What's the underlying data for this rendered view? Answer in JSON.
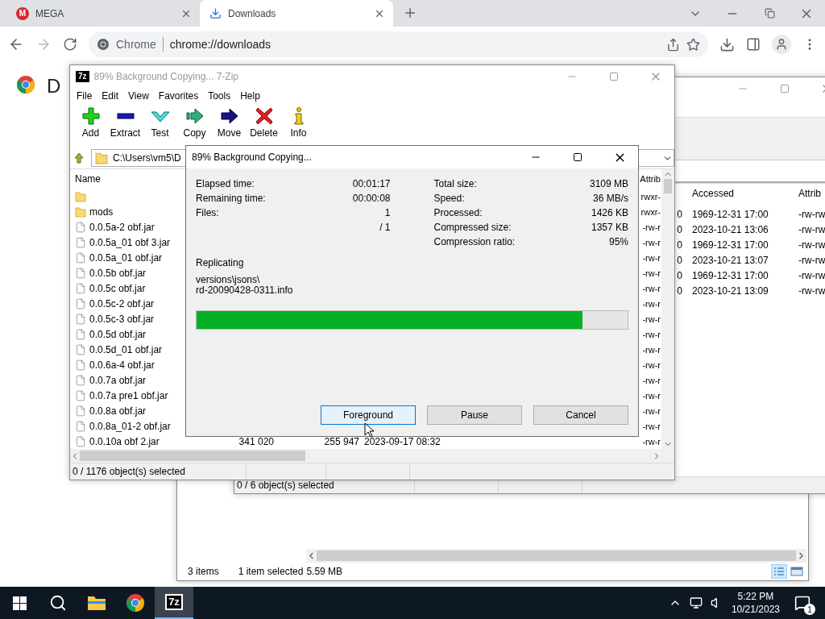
{
  "browser": {
    "tabs": [
      {
        "title": "MEGA",
        "kind": "mega",
        "icon_text": "M",
        "selected": false
      },
      {
        "title": "Downloads",
        "kind": "downloads",
        "selected": true
      }
    ],
    "omnibox": {
      "site_label": "Chrome",
      "url": "chrome://downloads"
    },
    "page": {
      "heading": "D"
    }
  },
  "explorer_window": {
    "status": {
      "items": "3 items",
      "selection": "1 item selected",
      "size": "5.59 MB"
    }
  },
  "archive_window_back": {
    "columns": [
      "Accessed",
      "Attrib"
    ],
    "rows": [
      {
        "column_tail": "0",
        "accessed": "1969-12-31 17:00",
        "attrib": "-rw-rw"
      },
      {
        "column_tail": "0",
        "accessed": "2023-10-21 13:06",
        "attrib": "-rw-rw"
      },
      {
        "column_tail": "0",
        "accessed": "1969-12-31 17:00",
        "attrib": "-rw-rw"
      },
      {
        "column_tail": "0",
        "accessed": "2023-10-21 13:07",
        "attrib": "-rw-rw"
      },
      {
        "column_tail": "0",
        "accessed": "1969-12-31 17:00",
        "attrib": "-rw-rw"
      },
      {
        "column_tail": "0",
        "accessed": "2023-10-21 13:09",
        "attrib": "-rw-rw"
      }
    ],
    "status": "0 / 6 object(s) selected"
  },
  "archive_window": {
    "icon_text": "7z",
    "title": "89% Background Copying... 7-Zip",
    "menu": [
      "File",
      "Edit",
      "View",
      "Favorites",
      "Tools",
      "Help"
    ],
    "toolbar": [
      {
        "label": "Add",
        "kind": "add"
      },
      {
        "label": "Extract",
        "kind": "extract"
      },
      {
        "label": "Test",
        "kind": "test"
      },
      {
        "label": "Copy",
        "kind": "copy"
      },
      {
        "label": "Move",
        "kind": "move"
      },
      {
        "label": "Delete",
        "kind": "delete"
      },
      {
        "label": "Info",
        "kind": "info"
      }
    ],
    "path": "C:\\Users\\vm5\\D",
    "columns": {
      "name": "Name",
      "attrib": "Attrib"
    },
    "rows": [
      {
        "kind": "folder",
        "attrib": "rwxr-"
      },
      {
        "name": "mods",
        "kind": "folder",
        "attrib": "rwxr-"
      },
      {
        "name": "0.0.5a-2 obf.jar",
        "kind": "file",
        "attrib": "-rw-r"
      },
      {
        "name": "0.0.5a_01 obf 3.jar",
        "kind": "file",
        "attrib": "-rw-r"
      },
      {
        "name": "0.0.5a_01 obf.jar",
        "kind": "file",
        "attrib": "-rw-r"
      },
      {
        "name": "0.0.5b obf.jar",
        "kind": "file",
        "attrib": "-rw-r"
      },
      {
        "name": "0.0.5c obf.jar",
        "kind": "file",
        "attrib": "-rw-r"
      },
      {
        "name": "0.0.5c-2 obf.jar",
        "kind": "file",
        "attrib": "-rw-r"
      },
      {
        "name": "0.0.5c-3 obf.jar",
        "kind": "file",
        "attrib": "-rw-r"
      },
      {
        "name": "0.0.5d obf.jar",
        "kind": "file",
        "attrib": "-rw-r"
      },
      {
        "name": "0.0.5d_01 obf.jar",
        "kind": "file",
        "attrib": "-rw-r"
      },
      {
        "name": "0.0.6a-4 obf.jar",
        "kind": "file",
        "attrib": "-rw-r"
      },
      {
        "name": "0.0.7a obf.jar",
        "kind": "file",
        "attrib": "-rw-r"
      },
      {
        "name": "0.0.7a pre1 obf.jar",
        "kind": "file",
        "attrib": "-rw-r"
      },
      {
        "name": "0.0.8a obf.jar",
        "kind": "file",
        "attrib": "-rw-r"
      },
      {
        "name": "0.0.8a_01-2 obf.jar",
        "kind": "file",
        "attrib": "-rw-r"
      },
      {
        "name": "0.0.10a obf 2.jar",
        "kind": "file",
        "size": "341 020",
        "packed": "255 947",
        "modified": "2023-09-17 08:32",
        "attrib": "-rw-r"
      }
    ],
    "status": "0 / 1176 object(s) selected"
  },
  "progress_dialog": {
    "title": "89% Background Copying...",
    "stats_left": [
      {
        "label": "Elapsed time:",
        "value": "00:01:17"
      },
      {
        "label": "Remaining time:",
        "value": "00:00:08"
      },
      {
        "label": "Files:",
        "value": "1"
      },
      {
        "value": "/ 1"
      }
    ],
    "stats_right": [
      {
        "label": "Total size:",
        "value": "3109 MB"
      },
      {
        "label": "Speed:",
        "value": "36 MB/s"
      },
      {
        "label": "Processed:",
        "value": "1426 KB"
      },
      {
        "label": "Compressed size:",
        "value": "1357 KB"
      },
      {
        "label": "Compression ratio:",
        "value": "95%"
      }
    ],
    "operation": "Replicating",
    "file_lines": [
      "versions\\jsons\\",
      "rd-20090428-0311.info"
    ],
    "progress": {
      "level": 0.895
    },
    "buttons": [
      {
        "label": "Foreground",
        "focused": true
      },
      {
        "label": "Pause",
        "focused": false
      },
      {
        "label": "Cancel",
        "focused": false
      }
    ]
  },
  "taskbar": {
    "apps": [
      {
        "kind": "start",
        "active": false
      },
      {
        "kind": "search",
        "active": false
      },
      {
        "kind": "explorer",
        "active": false
      },
      {
        "kind": "chrome",
        "active": false
      },
      {
        "kind": "sevenzip",
        "icon_text": "7z",
        "active": true
      }
    ],
    "time": "5:22 PM",
    "date": "10/21/2023",
    "notification_count": "1"
  }
}
